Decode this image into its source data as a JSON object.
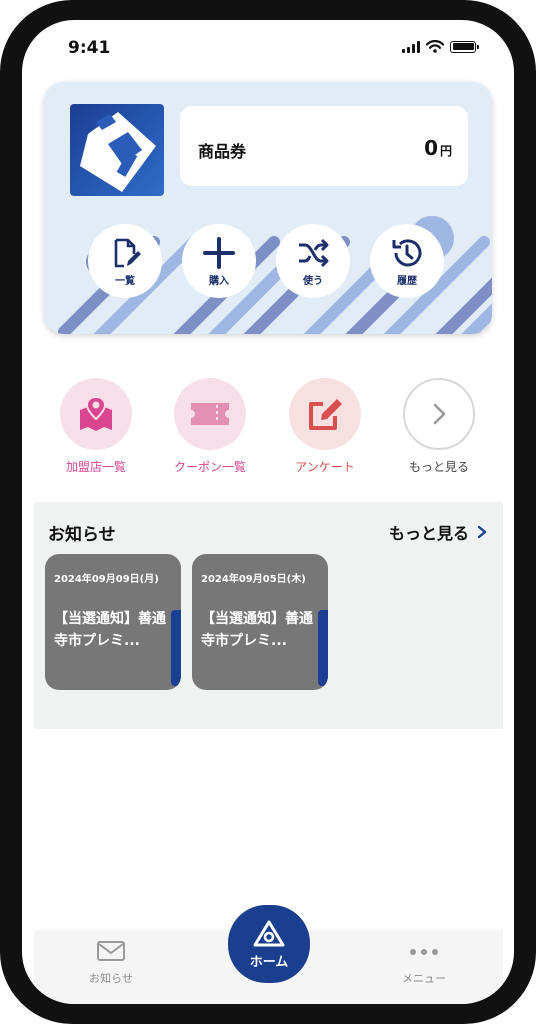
{
  "status_bar": {
    "time": "9:41"
  },
  "balance_card": {
    "voucher_name": "商品券",
    "amount": "0",
    "unit": "円",
    "actions": [
      {
        "label": "一覧",
        "icon": "document-edit-icon"
      },
      {
        "label": "購入",
        "icon": "plus-icon"
      },
      {
        "label": "使う",
        "icon": "shuffle-icon"
      },
      {
        "label": "履歴",
        "icon": "history-icon"
      }
    ]
  },
  "shortcuts": [
    {
      "label": "加盟店一覧",
      "icon": "store-map-icon",
      "color": "#d9468f"
    },
    {
      "label": "クーポン一覧",
      "icon": "ticket-icon",
      "color": "#d9468f"
    },
    {
      "label": "アンケート",
      "icon": "edit-icon",
      "color": "#d94f4f"
    },
    {
      "label": "もっと見る",
      "icon": "chevron-right-icon",
      "color": "#444444"
    }
  ],
  "news": {
    "title": "お知らせ",
    "more": "もっと見る",
    "items": [
      {
        "date": "2024年09月09日(月)",
        "text": "【当選通知】善通寺市プレミ..."
      },
      {
        "date": "2024年09月05日(木)",
        "text": "【当選通知】善通寺市プレミ..."
      }
    ]
  },
  "bottom_nav": {
    "news_label": "お知らせ",
    "home_label": "ホーム",
    "menu_label": "メニュー"
  },
  "colors": {
    "primary": "#1b3f8f",
    "card_bg": "#e1ecf6",
    "news_bg": "#f0f2f1"
  }
}
